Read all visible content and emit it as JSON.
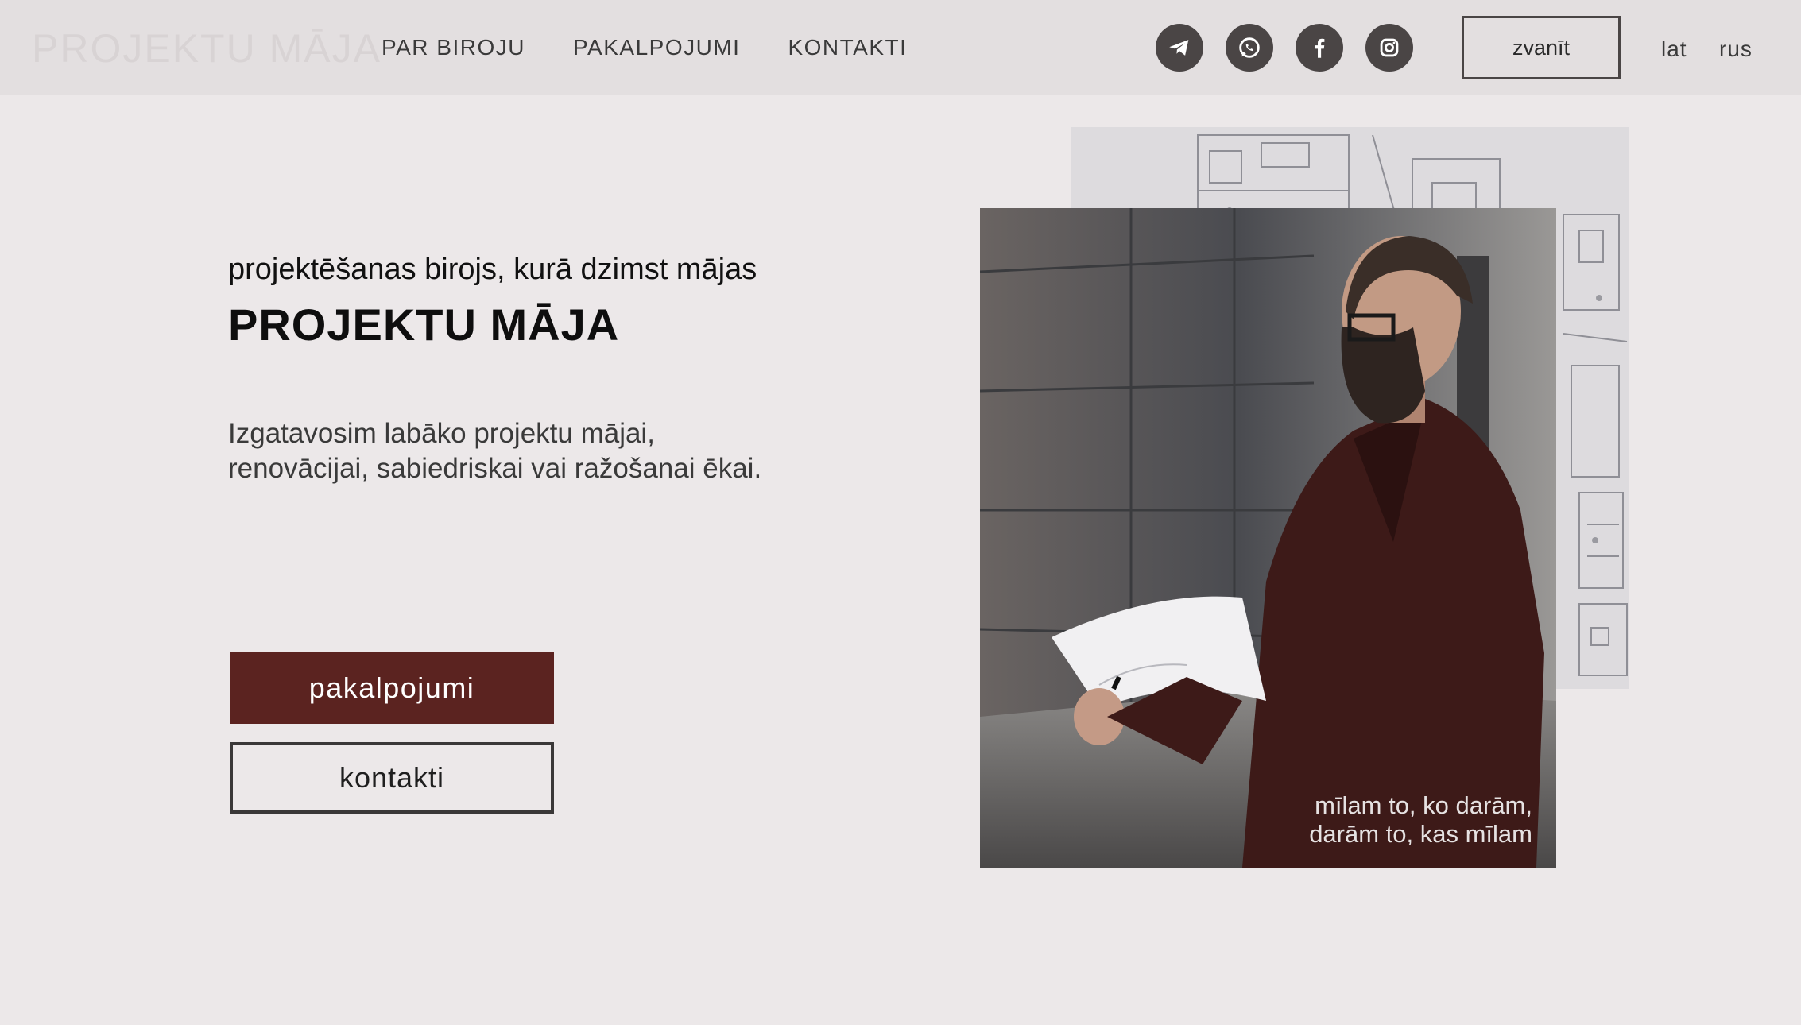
{
  "header": {
    "logo": "PROJEKTU MĀJA",
    "nav": [
      "PAR BIROJU",
      "PAKALPOJUMI",
      "KONTAKTI"
    ],
    "socials": [
      "telegram-icon",
      "whatsapp-icon",
      "facebook-icon",
      "instagram-icon"
    ],
    "call_button": "zvanīt",
    "languages": [
      "lat",
      "rus"
    ]
  },
  "hero": {
    "tagline": "projektēšanas birojs, kurā dzimst mājas",
    "title": "PROJEKTU MĀJA",
    "description": [
      "Izgatavosim labāko projektu mājai,",
      "renovācijai, sabiedriskai vai ražošanai ēkai."
    ],
    "primary_button": "pakalpojumi",
    "secondary_button": "kontakti"
  },
  "photo": {
    "caption": [
      "mīlam to, ko darām,",
      "darām to, kas mīlam"
    ]
  },
  "colors": {
    "background": "#ece8e9",
    "header": "#e3dfe0",
    "accent": "#5b2320",
    "icon_dark": "#4a4545"
  }
}
